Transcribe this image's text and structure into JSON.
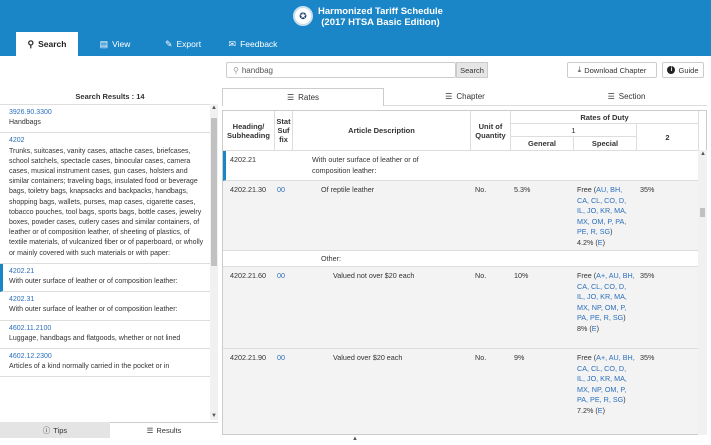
{
  "app": {
    "title_line1": "Harmonized Tariff Schedule",
    "title_line2": "(2017 HTSA Basic Edition)"
  },
  "nav": [
    {
      "label": "Search",
      "icon": "search-icon"
    },
    {
      "label": "View",
      "icon": "document-icon"
    },
    {
      "label": "Export",
      "icon": "export-icon"
    },
    {
      "label": "Feedback",
      "icon": "feedback-icon"
    }
  ],
  "search": {
    "value": "handbag",
    "button": "Search"
  },
  "toolbar": {
    "download": "Download Chapter",
    "guide": "Guide"
  },
  "results": {
    "title": "Search Results : 14"
  },
  "result_items": [
    {
      "code": "3926.90.3300",
      "text": "Handbags"
    },
    {
      "code": "4202",
      "text": "Trunks, suitcases, vanity cases, attache cases, briefcases, school satchels, spectacle cases, binocular cases, camera cases, musical instrument cases, gun cases, holsters and similar containers; traveling bags, insulated food or beverage bags, toiletry bags, knapsacks and backpacks, handbags, shopping bags, wallets, purses, map cases, cigarette cases, tobacco pouches, tool bags, sports bags, bottle cases, jewelry boxes, powder cases, cutlery cases and similar containers, of leather or of composition leather, of sheeting of plastics, of textile materials, of vulcanized fiber or of paperboard, or wholly or mainly covered with such materials or with paper:"
    },
    {
      "code": "4202.21",
      "text": "With outer surface of leather or of composition leather:"
    },
    {
      "code": "4202.31",
      "text": "With outer surface of leather or of composition leather:"
    },
    {
      "code": "4602.11.2100",
      "text": "Luggage, handbags and flatgoods, whether or not lined"
    },
    {
      "code": "4602.12.2300",
      "text": "Articles of a kind normally carried in the pocket or in"
    }
  ],
  "left_tabs": {
    "tips": "Tips",
    "results": "Results"
  },
  "view_tabs": {
    "rates": "Rates",
    "chapter": "Chapter",
    "section": "Section"
  },
  "columns": {
    "heading": "Heading/ Subheading",
    "stat": "Stat Suf fix",
    "desc": "Article Description",
    "unit": "Unit of Quantity",
    "rates": "Rates of Duty",
    "col1": "1",
    "general": "General",
    "special": "Special",
    "col2": "2"
  },
  "rows": [
    {
      "heading": "4202.21",
      "stat": "",
      "desc": "With outer surface of leather or of composition leather:",
      "unit": "",
      "general": "",
      "special_text": "",
      "special_codes": "",
      "special_end": "",
      "col2": ""
    },
    {
      "heading": "4202.21.30",
      "stat": "00",
      "desc": "Of reptile leather",
      "unit": "No.",
      "general": "5.3%",
      "special_text": "Free (",
      "special_codes": "AU, BH, CA, CL, CO, D, IL, JO, KR, MA, MX, OM, P, PA, PE, R, SG",
      "special_end": ")",
      "special_rate": "4.2% (",
      "special_rate_code": "E",
      "col2": "35%"
    },
    {
      "heading": "",
      "stat": "",
      "desc": "Other:",
      "unit": "",
      "general": "",
      "col2": ""
    },
    {
      "heading": "4202.21.60",
      "stat": "00",
      "desc": "Valued not over $20 each",
      "unit": "No.",
      "general": "10%",
      "special_text": "Free (",
      "special_codes": "A+, AU, BH, CA, CL, CO, D, IL, JO, KR, MA, MX, NP, OM, P, PA, PE, R, SG",
      "special_end": ")",
      "special_rate": "8% (",
      "special_rate_code": "E",
      "col2": "35%"
    },
    {
      "heading": "4202.21.90",
      "stat": "00",
      "desc": "Valued over $20 each",
      "unit": "No.",
      "general": "9%",
      "special_text": "Free (",
      "special_codes": "A+, AU, BH, CA, CL, CO, D, IL, JO, KR, MA, MX, NP, OM, P, PA, PE, R, SG",
      "special_end": ")",
      "special_rate": "7.2% (",
      "special_rate_code": "E",
      "col2": "35%"
    }
  ],
  "colors": {
    "header": "#1a86c8",
    "link": "#2a6ebb"
  }
}
